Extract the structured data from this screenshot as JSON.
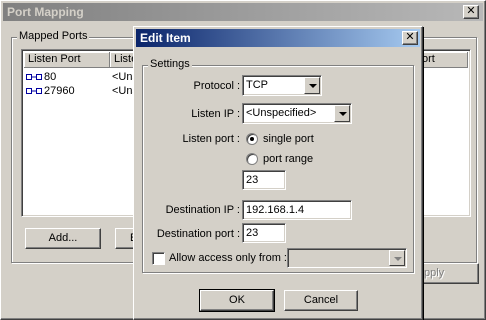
{
  "port_mapping": {
    "title": "Port Mapping",
    "close_glyph": "✕",
    "group_label": "Mapped Ports",
    "columns": [
      "Listen Port",
      "Liste",
      "ort"
    ],
    "rows": [
      {
        "port": "80",
        "listen_ip": "<Uns"
      },
      {
        "port": "27960",
        "listen_ip": "<Uns"
      }
    ],
    "add_button": "Add...",
    "edit_button_partial": "E",
    "apply_button_partial": "pply",
    "row_icon": "port-mapping-icon"
  },
  "edit_item": {
    "title": "Edit Item",
    "close_glyph": "✕",
    "group_label": "Settings",
    "protocol_label": "Protocol :",
    "protocol_value": "TCP",
    "listen_ip_label": "Listen IP :",
    "listen_ip_value": "<Unspecified>",
    "listen_port_label": "Listen port :",
    "single_port_label": "single port",
    "port_range_label": "port range",
    "selected_port_mode": "single port",
    "listen_port_value": "23",
    "destination_ip_label": "Destination IP :",
    "destination_ip_value": "192.168.1.4",
    "destination_port_label": "Destination port :",
    "destination_port_value": "23",
    "allow_access_label": "Allow access only from :",
    "allow_access_checked": false,
    "ok_button": "OK",
    "cancel_button": "Cancel"
  },
  "colors": {
    "face": "#d4d0c8",
    "active_title": "#0a246a",
    "inactive_title": "#808080"
  }
}
